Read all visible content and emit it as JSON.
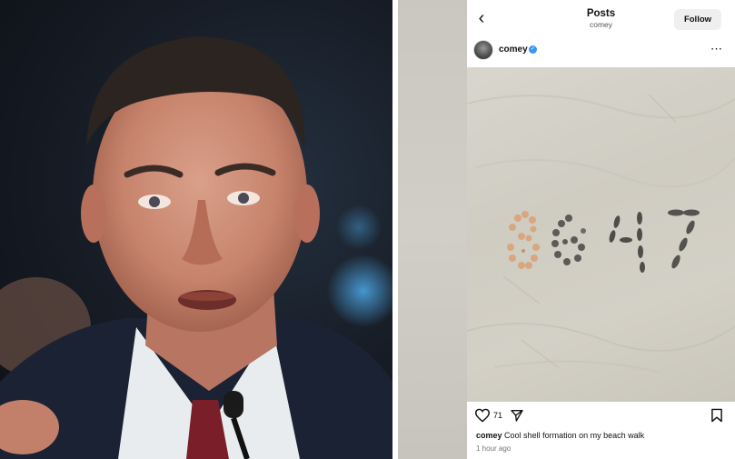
{
  "post_view": {
    "back_icon": "chevron-left-icon",
    "title": "Posts",
    "subtitle": "comey",
    "follow_label": "Follow"
  },
  "post_header": {
    "username": "comey",
    "verified_icon": "verified-badge-icon",
    "more_icon": "more-dots-icon"
  },
  "post_image": {
    "shell_text": "8647"
  },
  "actions": {
    "like_icon": "heart-icon",
    "like_count": "71",
    "share_icon": "paper-plane-icon",
    "save_icon": "bookmark-icon"
  },
  "caption": {
    "username": "comey",
    "text": "Cool shell formation on my beach walk"
  },
  "timestamp": "1 hour ago",
  "colors": {
    "verified_blue": "#3797f0",
    "follow_bg": "#efefef"
  }
}
